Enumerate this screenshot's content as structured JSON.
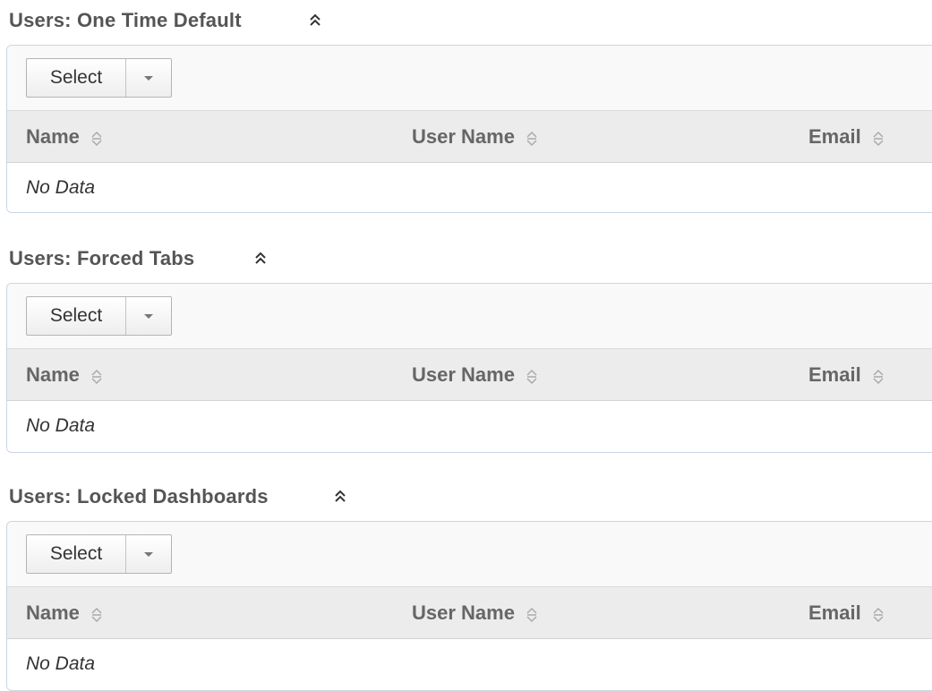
{
  "sections": [
    {
      "title": "Users: One Time Default",
      "collapse_icon": "double-chevron-up-icon",
      "select_label": "Select",
      "columns": [
        "Name",
        "User Name",
        "Email"
      ],
      "empty_text": "No Data"
    },
    {
      "title": "Users: Forced Tabs",
      "collapse_icon": "double-chevron-up-icon",
      "select_label": "Select",
      "columns": [
        "Name",
        "User Name",
        "Email"
      ],
      "empty_text": "No Data"
    },
    {
      "title": "Users: Locked Dashboards",
      "collapse_icon": "double-chevron-up-icon",
      "select_label": "Select",
      "columns": [
        "Name",
        "User Name",
        "Email"
      ],
      "empty_text": "No Data"
    }
  ],
  "colors": {
    "title_text": "#555555",
    "panel_border": "#c9d6e2",
    "toolbar_bg": "#f9f9f9",
    "header_bg": "#ececec",
    "header_text": "#666666"
  }
}
